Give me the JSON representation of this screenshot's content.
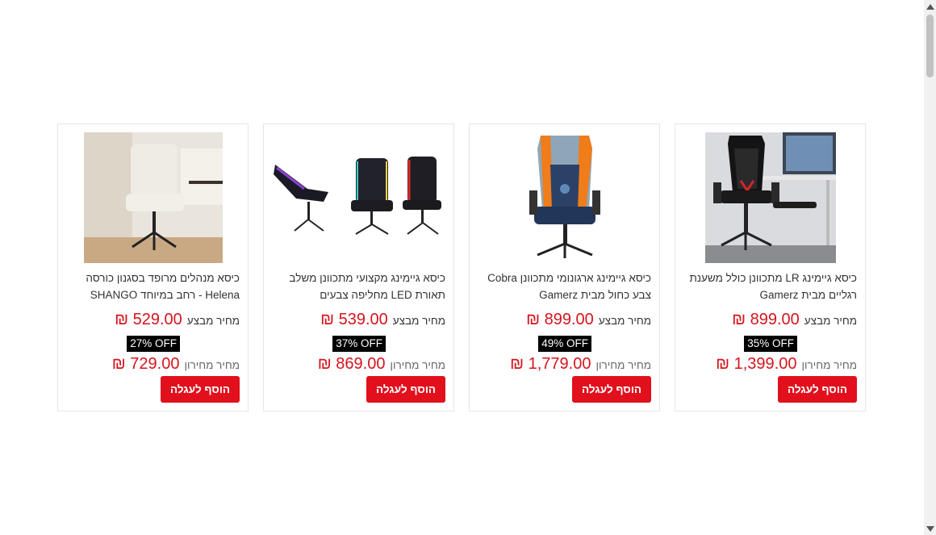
{
  "products": [
    {
      "title_line1": "כיסא גיימינג LR מתכוונן כולל משענת",
      "title_line2": "רגליים מבית Gamerz",
      "sale_label": "מחיר מבצע",
      "sale_price": "₪ 899.00",
      "discount": "35% OFF",
      "list_label": "מחיר מחירון",
      "list_price": "₪ 1,399.00",
      "button": "הוסף לעגלה",
      "image": "black-mesh-gaming-chair-image"
    },
    {
      "title_line1": "כיסא גיימינג ארגונומי מתכוונן Cobra",
      "title_line2": "צבע כחול מבית Gamerz",
      "sale_label": "מחיר מבצע",
      "sale_price": "₪ 899.00",
      "discount": "49% OFF",
      "list_label": "מחיר מחירון",
      "list_price": "₪ 1,779.00",
      "button": "הוסף לעגלה",
      "image": "blue-orange-gaming-chair-image"
    },
    {
      "title_line1": "כיסא גיימינג מקצועי מתכוונן משלב",
      "title_line2": "תאורת LED מחליפה צבעים",
      "sale_label": "מחיר מבצע",
      "sale_price": "₪ 539.00",
      "discount": "37% OFF",
      "list_label": "מחיר מחירון",
      "list_price": "₪ 869.00",
      "button": "הוסף לעגלה",
      "image": "led-gaming-chairs-image"
    },
    {
      "title_line1": "כיסא מנהלים מרופד בסגנון כורסה",
      "title_line2": "Helena - רחב במיוחד SHANGO",
      "sale_label": "מחיר מבצע",
      "sale_price": "₪ 529.00",
      "discount": "27% OFF",
      "list_label": "מחיר מחירון",
      "list_price": "₪ 729.00",
      "button": "הוסף לעגלה",
      "image": "white-upholstered-office-chair-image"
    }
  ],
  "colors": {
    "accent": "#e1101c",
    "price": "#d6141d",
    "badge": "#000000"
  }
}
